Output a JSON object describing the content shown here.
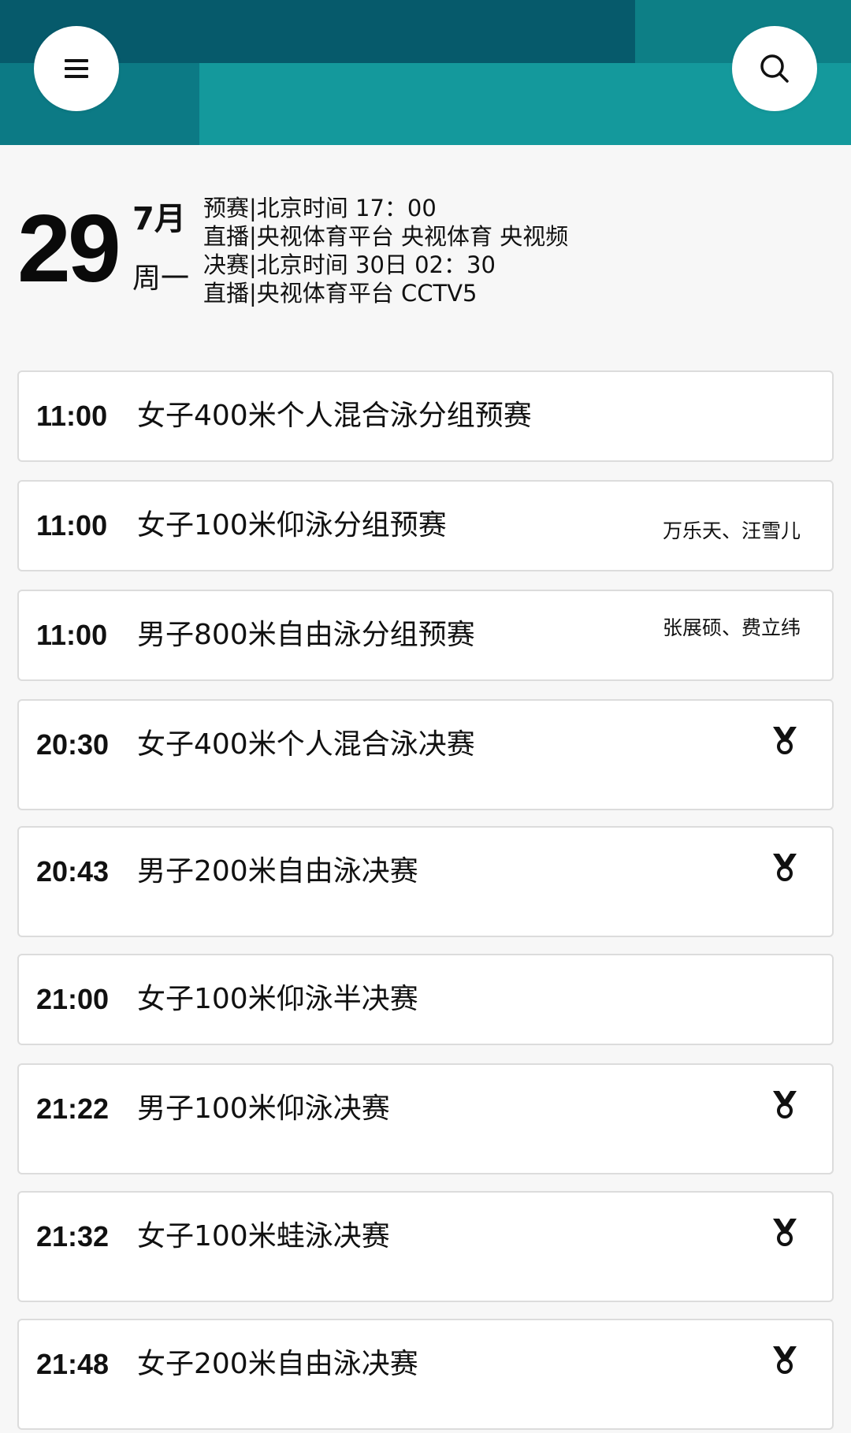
{
  "header": {
    "menu_icon": "hamburger-menu-icon",
    "search_icon": "search-icon",
    "colors": {
      "dark": "#065a6b",
      "mid": "#0c7a85",
      "teal": "#14999c"
    }
  },
  "date": {
    "day": "29",
    "month": "7月",
    "weekday": "周一"
  },
  "broadcast": {
    "lines": [
      "预赛|北京时间 17：00",
      "直播|央视体育平台 央视体育 央视频",
      "决赛|北京时间 30日 02：30",
      "直播|央视体育平台 CCTV5"
    ]
  },
  "events": [
    {
      "time": "11:00",
      "name": "女子400米个人混合泳分组预赛",
      "athletes": "",
      "medal": false
    },
    {
      "time": "11:00",
      "name": "女子100米仰泳分组预赛",
      "athletes": "万乐天、汪雪儿",
      "medal": false
    },
    {
      "time": "11:00",
      "name": "男子800米自由泳分组预赛",
      "athletes": "张展硕、费立纬",
      "medal": false
    },
    {
      "time": "20:30",
      "name": "女子400米个人混合泳决赛",
      "athletes": "",
      "medal": true
    },
    {
      "time": "20:43",
      "name": "男子200米自由泳决赛",
      "athletes": "",
      "medal": true
    },
    {
      "time": "21:00",
      "name": "女子100米仰泳半决赛",
      "athletes": "",
      "medal": false
    },
    {
      "time": "21:22",
      "name": "男子100米仰泳决赛",
      "athletes": "",
      "medal": true
    },
    {
      "time": "21:32",
      "name": "女子100米蛙泳决赛",
      "athletes": "",
      "medal": true
    },
    {
      "time": "21:48",
      "name": "女子200米自由泳决赛",
      "athletes": "",
      "medal": true
    }
  ]
}
